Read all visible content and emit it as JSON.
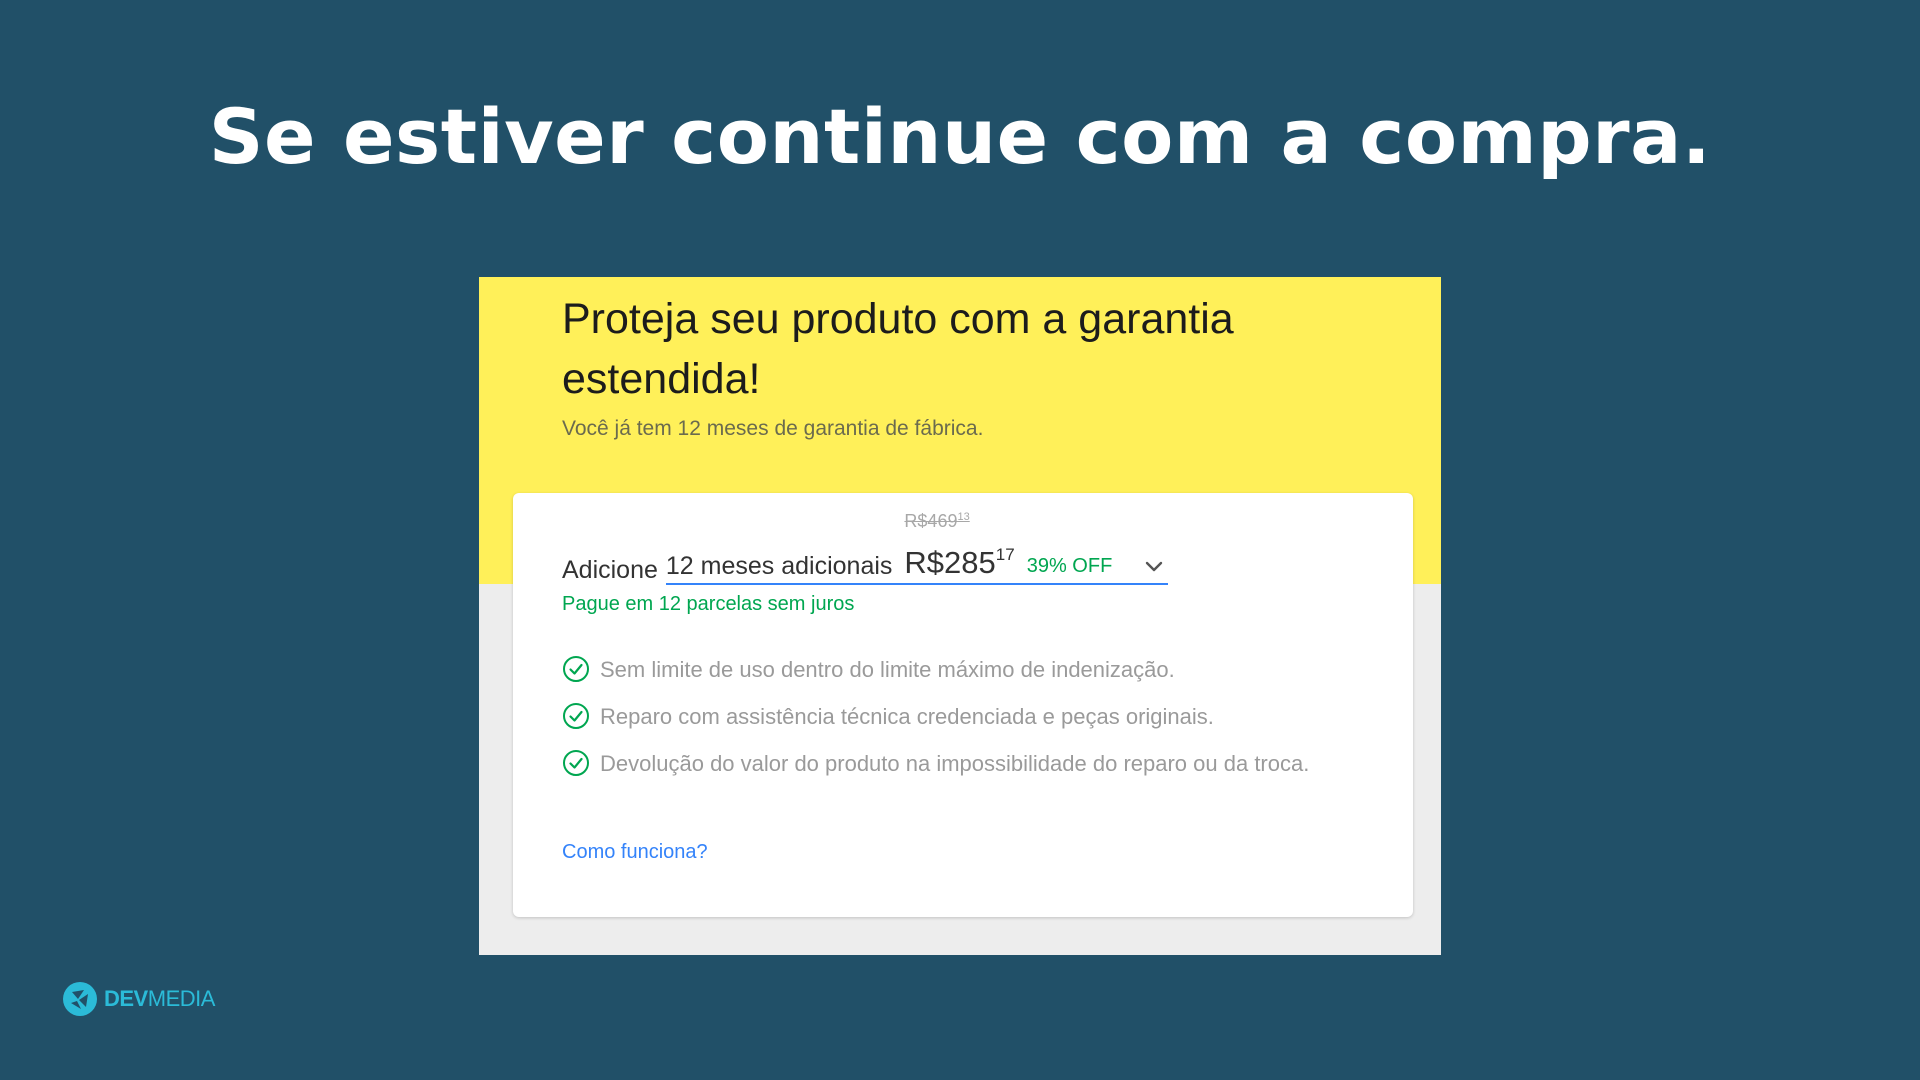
{
  "slide": {
    "title": "Se estiver continue com a compra."
  },
  "offer": {
    "title": "Proteja seu produto com a garantia estendida!",
    "subtitle": "Você já tem 12 meses de garantia de fábrica.",
    "add_label": "Adicione",
    "period_label": "12 meses adicionais",
    "old_price_int": "R$469",
    "old_price_cents": "13",
    "price_int": "R$285",
    "price_cents": "17",
    "discount": "39% OFF",
    "installments": "Pague em 12 parcelas sem juros",
    "benefits": [
      "Sem limite de uso dentro do limite máximo de indenização.",
      "Reparo com assistência técnica credenciada e peças originais.",
      "Devolução do valor do produto na impossibilidade do reparo ou da troca."
    ],
    "how_it_works": "Como funciona?"
  },
  "brand": {
    "part1": "DEV",
    "part2": "MEDIA"
  },
  "colors": {
    "background": "#215068",
    "yellow": "#fff059",
    "green": "#00a650",
    "blue_link": "#3483fa",
    "brand": "#2bbbd8"
  }
}
